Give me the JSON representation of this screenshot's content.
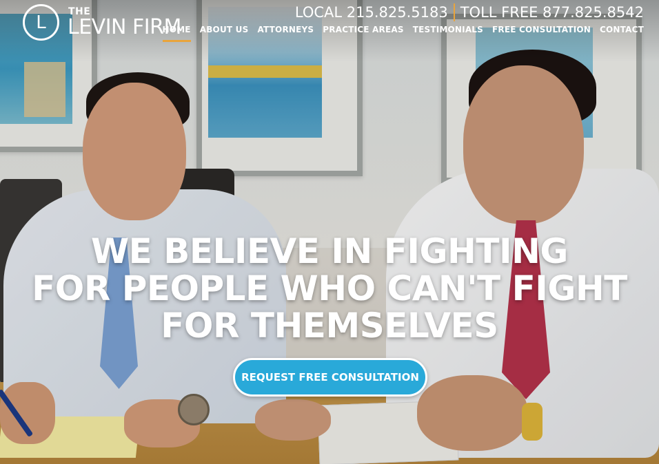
{
  "logo": {
    "initial": "L",
    "the": "THE",
    "name": "LEVIN FIRM"
  },
  "phones": {
    "local": "LOCAL 215.825.5183",
    "toll_free": "TOLL FREE 877.825.8542"
  },
  "nav": {
    "items": [
      {
        "label": "HOME",
        "active": true
      },
      {
        "label": "ABOUT US",
        "active": false
      },
      {
        "label": "ATTORNEYS",
        "active": false
      },
      {
        "label": "PRACTICE AREAS",
        "active": false
      },
      {
        "label": "TESTIMONIALS",
        "active": false
      },
      {
        "label": "FREE CONSULTATION",
        "active": false
      },
      {
        "label": "CONTACT",
        "active": false
      }
    ]
  },
  "hero": {
    "headline_line1": "WE BELIEVE IN FIGHTING",
    "headline_line2": "FOR PEOPLE WHO CAN'T FIGHT",
    "headline_line3": "FOR THEMSELVES",
    "cta_label": "REQUEST FREE CONSULTATION"
  },
  "colors": {
    "accent": "#e9a43b",
    "cta": "#29a9d9"
  }
}
